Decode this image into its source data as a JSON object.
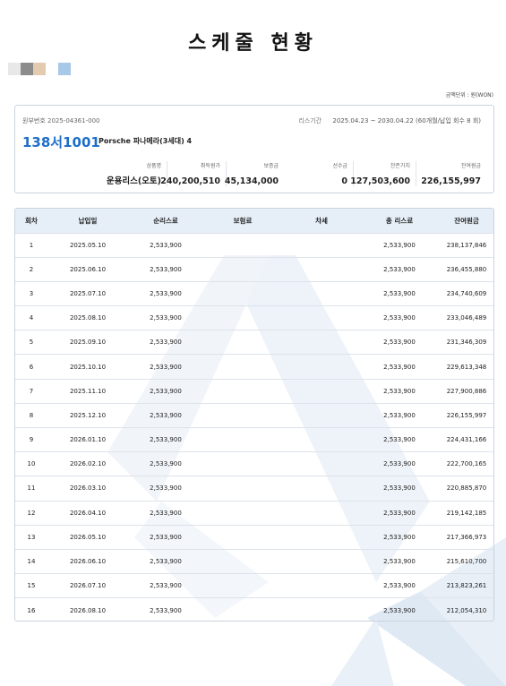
{
  "title": "스케줄 현황",
  "swatch_colors": [
    "#e8e8e8",
    "#8c8c8c",
    "#e3cbb0",
    "#ffffff",
    "#a8c8e8"
  ],
  "unit_note": "금액단위 : 원(WON)",
  "contract": {
    "number": "원부번호 2025-04361-000",
    "period_label": "리스기간",
    "period_value": "2025.04.23 ~ 2030.04.22 (60개월/납입 회수 8 회)",
    "plate": "138서1001",
    "model": "Porsche 파나메라(3세대) 4"
  },
  "summary": [
    {
      "label": "상품명",
      "value": "운용리스(오토)"
    },
    {
      "label": "취득원가",
      "value": "240,200,510"
    },
    {
      "label": "보증금",
      "value": "45,134,000"
    },
    {
      "label": "선수금",
      "value": "0"
    },
    {
      "label": "잔존가치",
      "value": "127,503,600"
    },
    {
      "label": "잔여원금",
      "value": "226,155,997"
    }
  ],
  "table": {
    "columns": [
      "회차",
      "납입일",
      "순리스료",
      "보험료",
      "차세",
      "총 리스료",
      "잔여원금"
    ],
    "rows": [
      [
        "1",
        "2025.05.10",
        "2,533,900",
        "",
        "",
        "2,533,900",
        "238,137,846"
      ],
      [
        "2",
        "2025.06.10",
        "2,533,900",
        "",
        "",
        "2,533,900",
        "236,455,880"
      ],
      [
        "3",
        "2025.07.10",
        "2,533,900",
        "",
        "",
        "2,533,900",
        "234,740,609"
      ],
      [
        "4",
        "2025.08.10",
        "2,533,900",
        "",
        "",
        "2,533,900",
        "233,046,489"
      ],
      [
        "5",
        "2025.09.10",
        "2,533,900",
        "",
        "",
        "2,533,900",
        "231,346,309"
      ],
      [
        "6",
        "2025.10.10",
        "2,533,900",
        "",
        "",
        "2,533,900",
        "229,613,348"
      ],
      [
        "7",
        "2025.11.10",
        "2,533,900",
        "",
        "",
        "2,533,900",
        "227,900,886"
      ],
      [
        "8",
        "2025.12.10",
        "2,533,900",
        "",
        "",
        "2,533,900",
        "226,155,997"
      ],
      [
        "9",
        "2026.01.10",
        "2,533,900",
        "",
        "",
        "2,533,900",
        "224,431,166"
      ],
      [
        "10",
        "2026.02.10",
        "2,533,900",
        "",
        "",
        "2,533,900",
        "222,700,165"
      ],
      [
        "11",
        "2026.03.10",
        "2,533,900",
        "",
        "",
        "2,533,900",
        "220,885,870"
      ],
      [
        "12",
        "2026.04.10",
        "2,533,900",
        "",
        "",
        "2,533,900",
        "219,142,185"
      ],
      [
        "13",
        "2026.05.10",
        "2,533,900",
        "",
        "",
        "2,533,900",
        "217,366,973"
      ],
      [
        "14",
        "2026.06.10",
        "2,533,900",
        "",
        "",
        "2,533,900",
        "215,610,700"
      ],
      [
        "15",
        "2026.07.10",
        "2,533,900",
        "",
        "",
        "2,533,900",
        "213,823,261"
      ],
      [
        "16",
        "2026.08.10",
        "2,533,900",
        "",
        "",
        "2,533,900",
        "212,054,310"
      ]
    ]
  }
}
